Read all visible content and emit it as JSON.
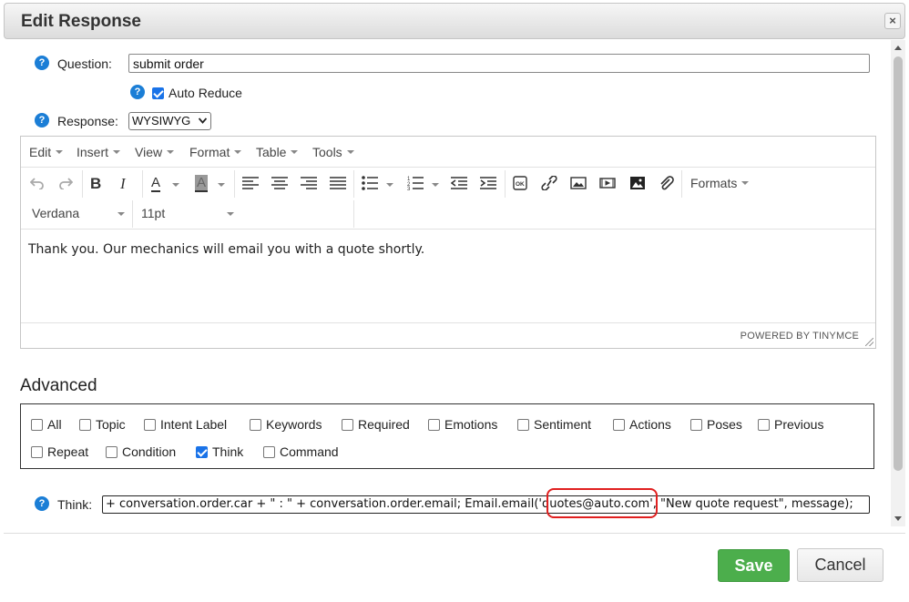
{
  "dialog": {
    "title": "Edit Response",
    "close": "×"
  },
  "question": {
    "label": "Question:",
    "value": "submit order",
    "help": "?"
  },
  "auto_reduce": {
    "label": "Auto Reduce",
    "checked": true,
    "help": "?"
  },
  "response": {
    "label": "Response:",
    "format": "WYSIWYG",
    "help": "?"
  },
  "editor": {
    "menus": [
      "Edit",
      "Insert",
      "View",
      "Format",
      "Table",
      "Tools"
    ],
    "formats_label": "Formats",
    "font_family": "Verdana",
    "font_size": "11pt",
    "content": "Thank you. Our mechanics will email you with a quote shortly.",
    "powered_by": "POWERED BY TINYMCE"
  },
  "advanced": {
    "title": "Advanced",
    "options": [
      {
        "label": "All",
        "checked": false
      },
      {
        "label": "Topic",
        "checked": false
      },
      {
        "label": "Intent Label",
        "checked": false
      },
      {
        "label": "Keywords",
        "checked": false
      },
      {
        "label": "Required",
        "checked": false
      },
      {
        "label": "Emotions",
        "checked": false
      },
      {
        "label": "Sentiment",
        "checked": false
      },
      {
        "label": "Actions",
        "checked": false
      },
      {
        "label": "Poses",
        "checked": false
      },
      {
        "label": "Previous",
        "checked": false
      },
      {
        "label": "Repeat",
        "checked": false
      },
      {
        "label": "Condition",
        "checked": false
      },
      {
        "label": "Think",
        "checked": true
      },
      {
        "label": "Command",
        "checked": false
      }
    ]
  },
  "think": {
    "label": "Think:",
    "help": "?",
    "value": "+ conversation.order.car + \" : \" + conversation.order.email; Email.email('quotes@auto.com', \"New quote request\", message);"
  },
  "buttons": {
    "save": "Save",
    "cancel": "Cancel"
  },
  "colors": {
    "save": "#4cae4c",
    "help": "#1b7ed6",
    "highlight": "#e02020"
  }
}
